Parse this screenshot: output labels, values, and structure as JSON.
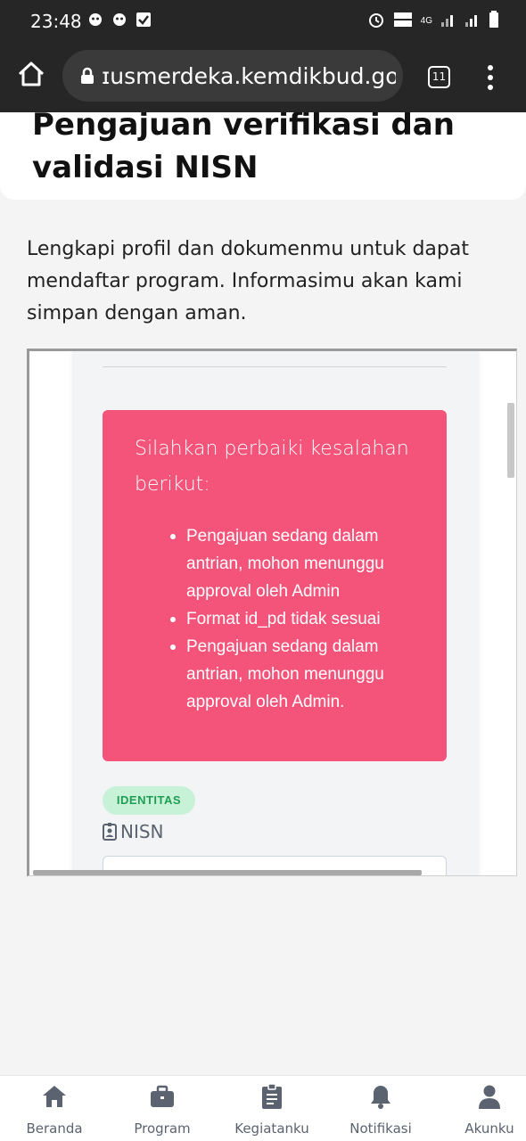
{
  "status_bar": {
    "time": "23:48",
    "network_label": "4G",
    "icons": [
      "notification-icon",
      "notification-icon",
      "check-icon",
      "alarm-icon",
      "volte-icon",
      "signal-icon",
      "signal-icon",
      "battery-icon"
    ]
  },
  "browser": {
    "url": "ɪusmerdeka.kemdikbud.go.id",
    "tab_count": "11"
  },
  "page": {
    "title": "Pengajuan verifikasi dan validasi NISN",
    "intro": "Lengkapi profil dan dokumenmu untuk dapat mendaftar program. Informasimu akan kami simpan dengan aman."
  },
  "form": {
    "error_heading": "Silahkan perbaiki kesalahan berikut:",
    "errors": [
      "Pengajuan sedang dalam antrian, mohon menunggu approval oleh Admin",
      "Format id_pd tidak sesuai",
      "Pengajuan sedang dalam antrian, mohon menunggu approval oleh Admin."
    ],
    "badge": "IDENTITAS",
    "nisn_label": "NISN",
    "nisn_value": ""
  },
  "bottom_nav": [
    {
      "label": "Beranda",
      "icon": "home-icon"
    },
    {
      "label": "Program",
      "icon": "briefcase-icon"
    },
    {
      "label": "Kegiatanku",
      "icon": "clipboard-icon"
    },
    {
      "label": "Notifikasi",
      "icon": "bell-icon"
    },
    {
      "label": "Akunku",
      "icon": "user-icon"
    }
  ],
  "colors": {
    "error_bg": "#f5547a",
    "badge_bg": "#c8f2d8",
    "badge_text": "#1f9d55",
    "browser_bg": "#262626"
  }
}
